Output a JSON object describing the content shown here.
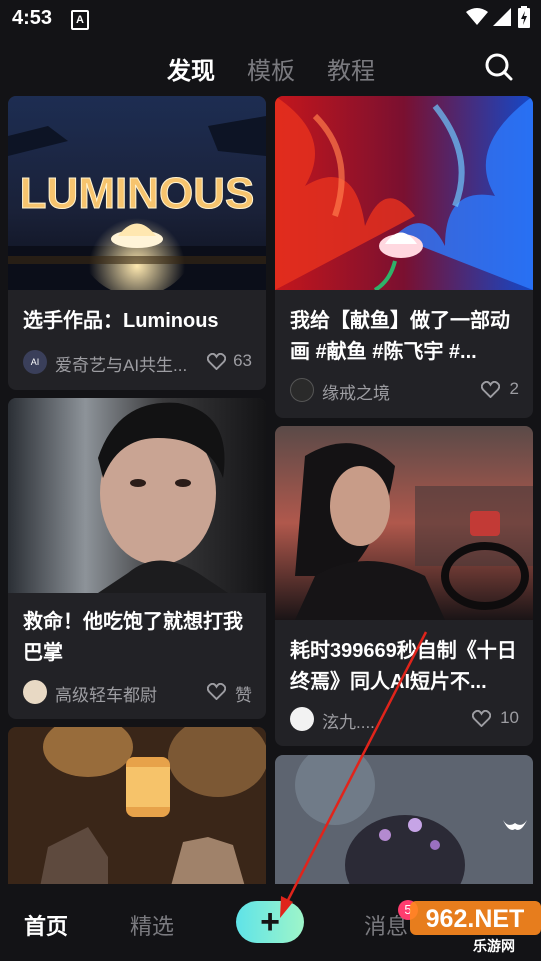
{
  "status": {
    "time": "4:53",
    "notif_icon": "A"
  },
  "top_tabs": {
    "discover": "发现",
    "templates": "模板",
    "tutorials": "教程"
  },
  "cards": [
    {
      "title": "选手作品：Luminous",
      "author": "爱奇艺与AI共生...",
      "likes": "63",
      "thumb_text": "LUMINOUS",
      "avatar_text": "AI"
    },
    {
      "title": "我给【献鱼】做了一部动画 #献鱼 #陈飞宇 #...",
      "author": "缘戒之境",
      "likes": "2"
    },
    {
      "title": "救命！他吃饱了就想打我巴掌",
      "author": "高级轻车都尉",
      "likes": "赞"
    },
    {
      "title": "耗时399669秒自制《十日终焉》同人AI短片不...",
      "author": "泫九.....",
      "likes": "10"
    }
  ],
  "bottom_nav": {
    "home": "首页",
    "featured": "精选",
    "add": "+",
    "messages": "消息",
    "badge": "5"
  },
  "watermark": {
    "brand": "962.NET",
    "sub": "乐游网"
  },
  "colors": {
    "accent_from": "#5fe3e8",
    "accent_to": "#9ef5c9",
    "badge": "#ff3c6f",
    "annotation_arrow": "#e0241b"
  }
}
